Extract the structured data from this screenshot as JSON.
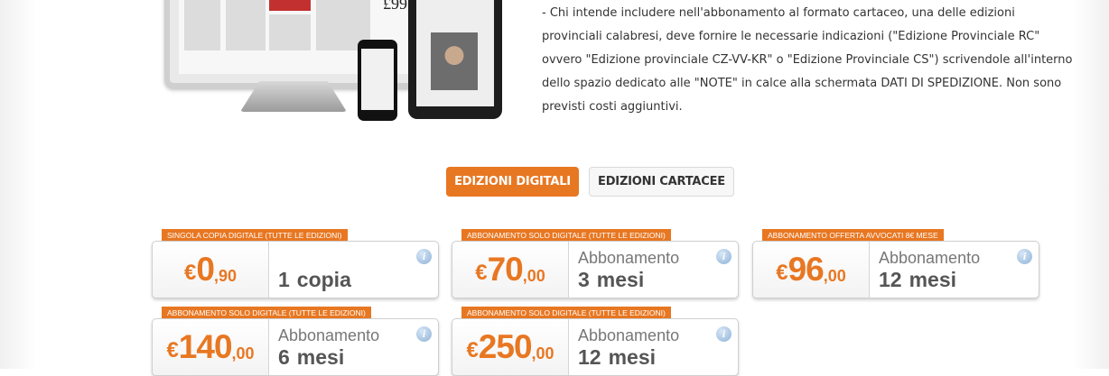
{
  "note": "- Chi intende includere nell'abbonamento al formato cartaceo, una delle edizioni provinciali calabresi, deve fornire le necessarie indicazioni (\"Edizione Provinciale RC\" ovvero \"Edizione provinciale CZ-VV-KR\" o \"Edizione Provinciale CS\") scrivendole all'interno dello spazio dedicato alle \"NOTE\" in calce alla schermata DATI DI SPEDIZIONE. Non sono previsti costi aggiuntivi.",
  "illustration": {
    "newspaper_price": "£99"
  },
  "tabs": {
    "digital": "EDIZIONI DIGITALI",
    "print": "EDIZIONI CARTACEE"
  },
  "accent_color": "#e87722",
  "plans": [
    {
      "label": "Singola copia digitale (tutte le edizioni)",
      "currency": "€",
      "price_int": "0",
      "price_dec": ",90",
      "sub": "",
      "qty": "1",
      "unit": "copia"
    },
    {
      "label": "Abbonamento solo digitale (tutte le edizioni)",
      "currency": "€",
      "price_int": "70",
      "price_dec": ",00",
      "sub": "Abbonamento",
      "qty": "3",
      "unit": "mesi"
    },
    {
      "label": "Abbonamento offerta avvocati 8€ mese",
      "currency": "€",
      "price_int": "96",
      "price_dec": ",00",
      "sub": "Abbonamento",
      "qty": "12",
      "unit": "mesi"
    },
    {
      "label": "Abbonamento solo digitale (tutte le edizioni)",
      "currency": "€",
      "price_int": "140",
      "price_dec": ",00",
      "sub": "Abbonamento",
      "qty": "6",
      "unit": "mesi"
    },
    {
      "label": "Abbonamento solo digitale (tutte le edizioni)",
      "currency": "€",
      "price_int": "250",
      "price_dec": ",00",
      "sub": "Abbonamento",
      "qty": "12",
      "unit": "mesi"
    }
  ],
  "info_icon_glyph": "i"
}
